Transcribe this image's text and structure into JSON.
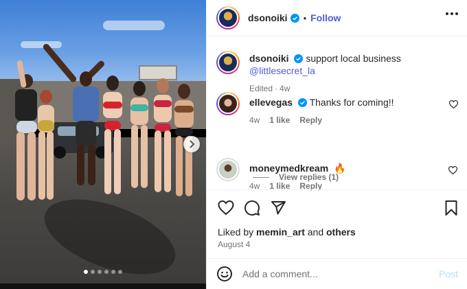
{
  "post": {
    "author": "dsonoiki",
    "follow_label": "Follow",
    "dot_sep": "•"
  },
  "caption": {
    "author": "dsonoiki",
    "text": "support local business",
    "mention": "@littlesecret_la",
    "edited": "Edited",
    "age": "4w"
  },
  "comments": [
    {
      "author": "ellevegas",
      "text": "Thanks for coming!!",
      "age": "4w",
      "likes": "1 like",
      "reply_label": "Reply"
    },
    {
      "author": "moneymedkream",
      "text": "🔥",
      "age": "4w",
      "likes": "1 like",
      "reply_label": "Reply"
    }
  ],
  "view_replies": "View replies (1)",
  "likes": {
    "prefix": "Liked by",
    "user": "memin_art",
    "joiner": "and",
    "others": "others"
  },
  "date": "August 4",
  "add_comment": {
    "placeholder": "Add a comment...",
    "post_label": "Post"
  },
  "carousel": {
    "slide_count": 6,
    "current_index": 0
  },
  "colors": {
    "accent": "#4f5bd5",
    "verified": "#0095f6",
    "muted": "#737373",
    "post_disabled": "#b2dffc"
  },
  "icons": {
    "verified": "verified-badge-icon",
    "more": "more-horizontal-icon",
    "like": "heart-icon",
    "comment": "comment-bubble-icon",
    "share": "paper-plane-icon",
    "save": "bookmark-icon",
    "emoji": "smiley-icon",
    "next": "chevron-right-icon"
  }
}
